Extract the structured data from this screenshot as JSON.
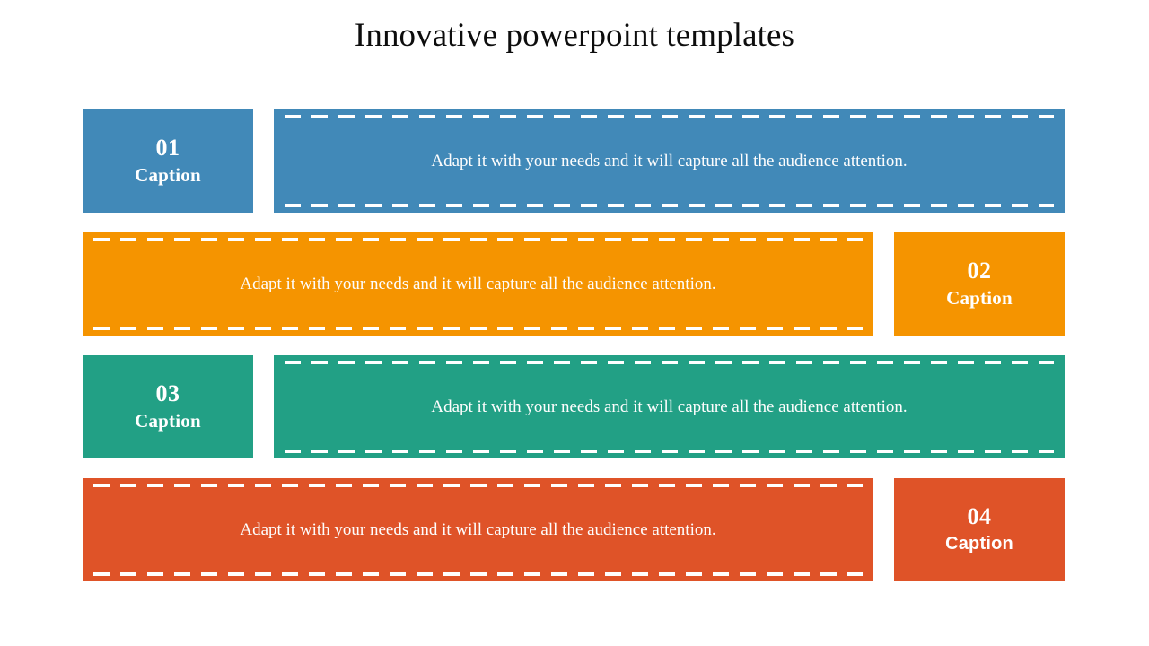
{
  "slide": {
    "title": "Innovative powerpoint templates",
    "background": "#ffffff",
    "title_color": "#0d0d0d"
  },
  "rows": [
    {
      "number": "01",
      "caption": "Caption",
      "body": "Adapt it with your needs and it will capture all the audience attention.",
      "color": "#4189b8",
      "layout": "caption-left"
    },
    {
      "number": "02",
      "caption": "Caption",
      "body": "Adapt it with your needs and it will capture all the audience attention.",
      "color": "#f59400",
      "layout": "caption-right"
    },
    {
      "number": "03",
      "caption": "Caption",
      "body": "Adapt it with your needs and it will capture all the audience attention.",
      "color": "#22a085",
      "layout": "caption-left"
    },
    {
      "number": "04",
      "caption": "Caption",
      "body": "Adapt it with your needs and it will capture all the audience attention.",
      "color": "#df5328",
      "layout": "caption-right"
    }
  ]
}
